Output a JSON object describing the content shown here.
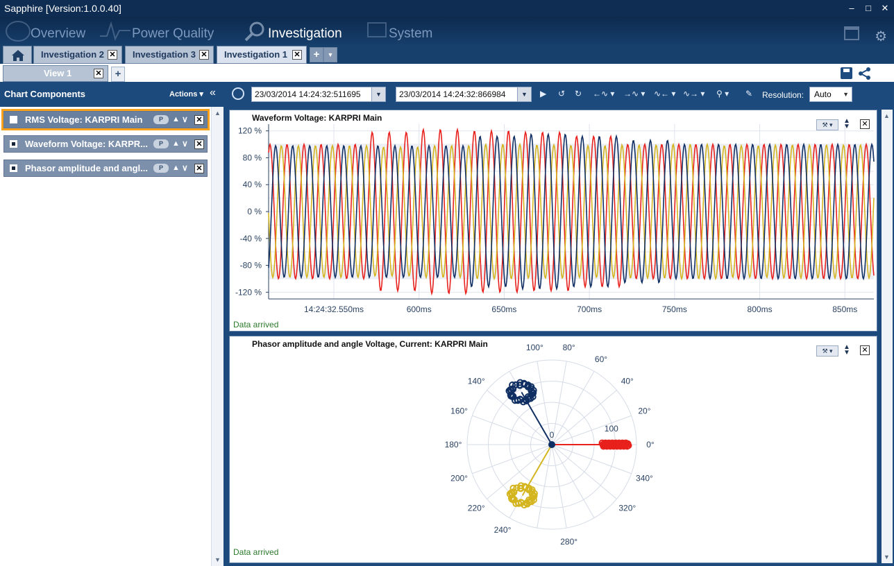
{
  "window": {
    "title": "Sapphire [Version:1.0.0.40]"
  },
  "nav": {
    "items": [
      {
        "label": "Overview"
      },
      {
        "label": "Power Quality"
      },
      {
        "label": "Investigation"
      },
      {
        "label": "System"
      }
    ],
    "active": "Investigation"
  },
  "doc_tabs": [
    {
      "label": "Investigation 2"
    },
    {
      "label": "Investigation 3"
    },
    {
      "label": "Investigation 1"
    }
  ],
  "active_doc_tab": "Investigation 1",
  "view_tab": {
    "label": "View 1"
  },
  "left_panel": {
    "title": "Chart Components",
    "actions": "Actions ▾",
    "items": [
      {
        "label": "RMS Voltage: KARPRI Main",
        "checked": false,
        "badge": "P"
      },
      {
        "label": "Waveform Voltage: KARPR...",
        "checked": true,
        "badge": "P"
      },
      {
        "label": "Phasor amplitude and angl...",
        "checked": true,
        "badge": "P"
      }
    ]
  },
  "toolbar": {
    "start_time": "23/03/2014 14:24:32:511695",
    "end_time": "23/03/2014 14:24:32:866984",
    "resolution_label": "Resolution:",
    "resolution_value": "Auto"
  },
  "colors": {
    "phase_red": "#e8211d",
    "phase_yellow": "#d4b51f",
    "phase_blue": "#102f63",
    "accent": "#1d4a7c"
  },
  "chart_data": [
    {
      "type": "line",
      "title": "Waveform Voltage: KARPRI Main",
      "yticks": [
        "120 %",
        "80 %",
        "40 %",
        "0 %",
        "-40 %",
        "-80 %",
        "-120 %"
      ],
      "ylim": [
        -130,
        130
      ],
      "xticks": [
        "14:24:32.550ms",
        "600ms",
        "650ms",
        "700ms",
        "750ms",
        "800ms",
        "850ms"
      ],
      "xlim_ms": [
        511.7,
        867.0
      ],
      "xtick_values_ms": [
        550,
        600,
        650,
        700,
        750,
        800,
        850
      ],
      "frequency_hz": 100,
      "series": [
        {
          "color": "#e8211d",
          "amplitude_pct": [
            100,
            100,
            118,
            122,
            120,
            118,
            112,
            100,
            100,
            100,
            100,
            100
          ],
          "phase_deg": 0
        },
        {
          "color": "#d4b51f",
          "amplitude_pct": [
            98,
            98,
            96,
            98,
            100,
            99,
            98,
            99,
            100,
            98,
            99,
            99
          ],
          "phase_deg": 120
        },
        {
          "color": "#102f63",
          "amplitude_pct": [
            98,
            98,
            98,
            98,
            112,
            115,
            112,
            106,
            100,
            100,
            100,
            100
          ],
          "phase_deg": 240
        }
      ],
      "status": "Data arrived"
    },
    {
      "type": "scatter",
      "title": "Phasor amplitude and angle Voltage, Current: KARPRI Main",
      "angle_labels": [
        "0°",
        "20°",
        "40°",
        "60°",
        "80°",
        "100°",
        "140°",
        "160°",
        "180°",
        "200°",
        "220°",
        "240°",
        "280°",
        "320°",
        "340°"
      ],
      "radial_labels": [
        "0",
        "100"
      ],
      "radial_max": 140,
      "clusters": [
        {
          "color": "#e8211d",
          "angle_deg": 0,
          "radius": 105
        },
        {
          "color": "#102f63",
          "angle_deg": 120,
          "radius": 100
        },
        {
          "color": "#d4b51f",
          "angle_deg": 240,
          "radius": 97
        }
      ],
      "status": "Data arrived"
    }
  ]
}
